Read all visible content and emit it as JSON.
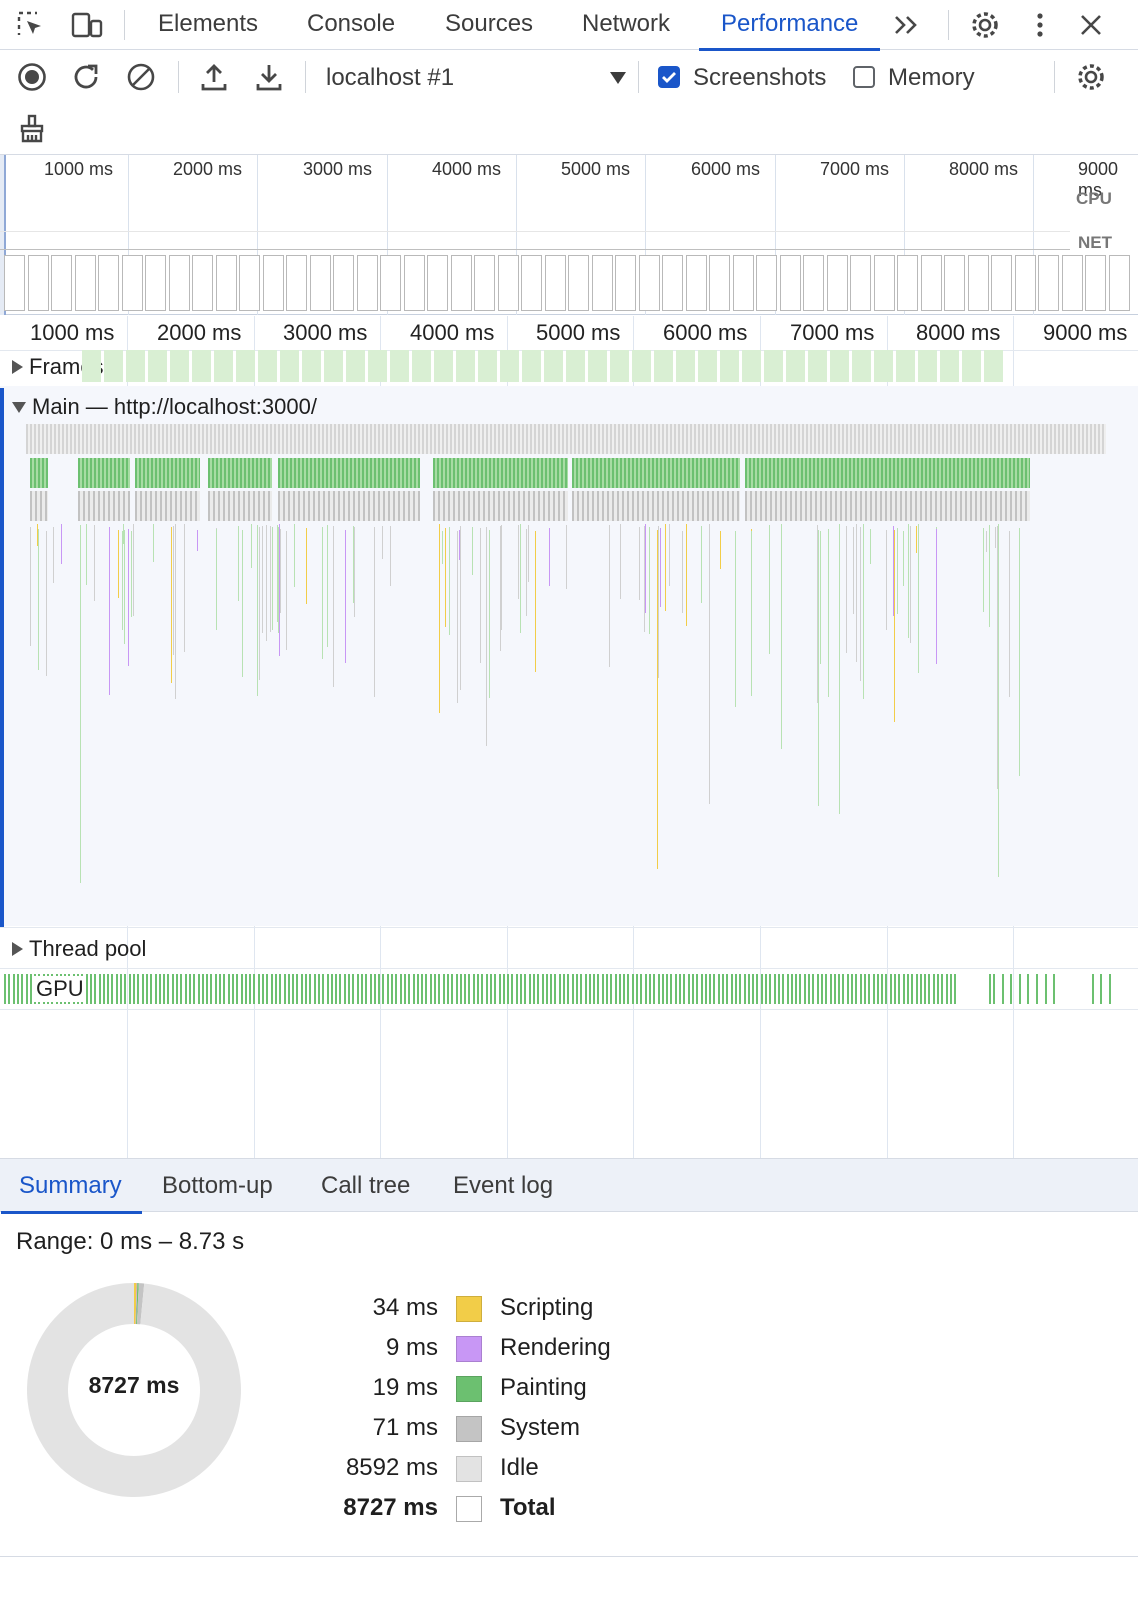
{
  "tabs": {
    "items": [
      "Elements",
      "Console",
      "Sources",
      "Network",
      "Performance"
    ],
    "active": "Performance"
  },
  "toolbar": {
    "target": "localhost #1",
    "screenshots_label": "Screenshots",
    "screenshots_checked": true,
    "memory_label": "Memory",
    "memory_checked": false
  },
  "overview": {
    "ticks": [
      "1000 ms",
      "2000 ms",
      "3000 ms",
      "4000 ms",
      "5000 ms",
      "6000 ms",
      "7000 ms",
      "8000 ms",
      "9000 ms"
    ],
    "cpu_label": "CPU",
    "net_label": "NET"
  },
  "flame": {
    "ticks": [
      "1000 ms",
      "2000 ms",
      "3000 ms",
      "4000 ms",
      "5000 ms",
      "6000 ms",
      "7000 ms",
      "8000 ms",
      "9000 ms"
    ],
    "frames_label": "Frames",
    "main_label": "Main — http://localhost:3000/",
    "thread_pool_label": "Thread pool",
    "gpu_label": "GPU"
  },
  "bottom_tabs": {
    "items": [
      "Summary",
      "Bottom-up",
      "Call tree",
      "Event log"
    ],
    "active": "Summary"
  },
  "summary": {
    "range": "Range: 0 ms – 8.73 s",
    "total_center": "8727 ms",
    "categories": [
      {
        "value": "34 ms",
        "ms": 34,
        "name": "Scripting",
        "color": "#f2cd48"
      },
      {
        "value": "9 ms",
        "ms": 9,
        "name": "Rendering",
        "color": "#c897f5"
      },
      {
        "value": "19 ms",
        "ms": 19,
        "name": "Painting",
        "color": "#6cc070"
      },
      {
        "value": "71 ms",
        "ms": 71,
        "name": "System",
        "color": "#c4c4c4"
      },
      {
        "value": "8592 ms",
        "ms": 8592,
        "name": "Idle",
        "color": "#e3e3e3"
      }
    ],
    "total": {
      "value": "8727 ms",
      "name": "Total"
    }
  }
}
